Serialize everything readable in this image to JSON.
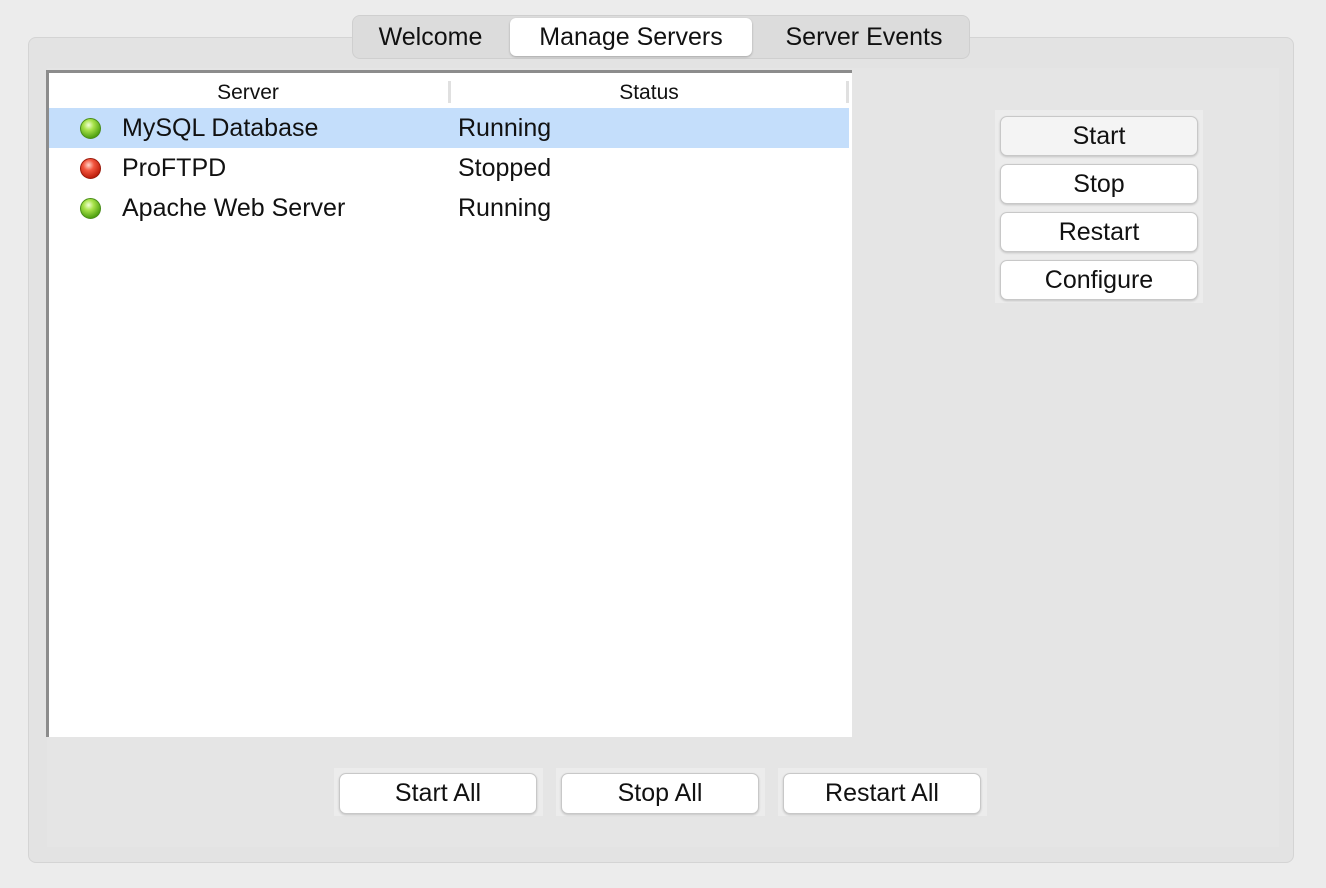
{
  "tabs": {
    "welcome": "Welcome",
    "manage_servers": "Manage Servers",
    "server_events": "Server Events"
  },
  "table": {
    "columns": [
      "Server",
      "Status"
    ],
    "rows": [
      {
        "name": "MySQL Database",
        "status": "Running",
        "indicator": "green-status-light",
        "selected": true
      },
      {
        "name": "ProFTPD",
        "status": "Stopped",
        "indicator": "red-status-light",
        "selected": false
      },
      {
        "name": "Apache Web Server",
        "status": "Running",
        "indicator": "green-status-light",
        "selected": false
      }
    ]
  },
  "server_actions": {
    "start": "Start",
    "stop": "Stop",
    "restart": "Restart",
    "configure": "Configure"
  },
  "bulk_actions": {
    "start_all": "Start All",
    "stop_all": "Stop All",
    "restart_all": "Restart All"
  },
  "colors": {
    "selection": "#c4defb",
    "running": "#6cc02a",
    "stopped": "#d83520",
    "panel": "#e3e3e3"
  }
}
